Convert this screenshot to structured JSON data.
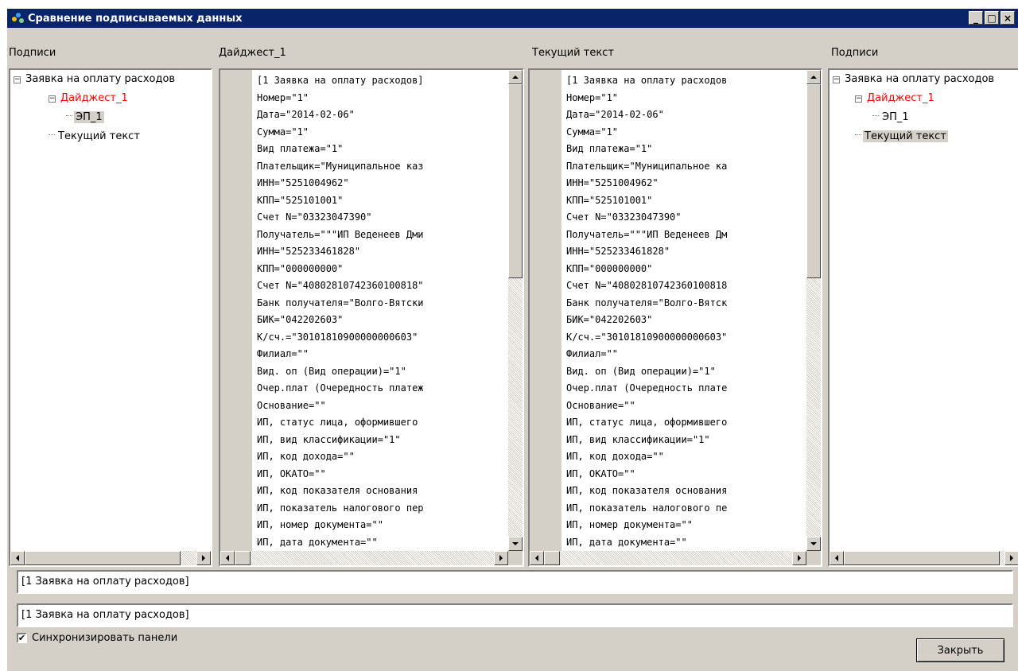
{
  "window": {
    "title": "Сравнение подписываемых данных",
    "minimize_glyph": "_",
    "maximize_glyph": "□",
    "close_glyph": "×"
  },
  "left_panel": {
    "label": "Подписи",
    "tree": {
      "root": "Заявка на оплату расходов",
      "digest": "Дайджест_1",
      "signature": "ЭП_1",
      "current_text": "Текущий текст"
    }
  },
  "digest_panel": {
    "label": "Дайджест_1",
    "lines": [
      "[1 Заявка на оплату расходов]",
      "Номер=\"1\"",
      "Дата=\"2014-02-06\"",
      "Сумма=\"1\"",
      "Вид платежа=\"1\"",
      "Плательщик=\"Муниципальное каз",
      "ИНН=\"5251004962\"",
      "КПП=\"525101001\"",
      "Счет N=\"03323047390\"",
      "Получатель=\"\"\"ИП Веденеев Дми",
      "ИНН=\"525233461828\"",
      "КПП=\"000000000\"",
      "Счет N=\"40802810742360100818\"",
      "Банк получателя=\"Волго-Вятски",
      "БИК=\"042202603\"",
      "К/сч.=\"30101810900000000603\"",
      "Филиал=\"\"",
      "Вид. оп (Вид операции)=\"1\"",
      "Очер.плат (Очередность платеж",
      "Основание=\"\"",
      "ИП, статус лица, оформившего",
      "ИП, вид классификации=\"1\"",
      "ИП, код дохода=\"\"",
      "ИП, ОКАТО=\"\"",
      "ИП, код показателя основания",
      "ИП, показатель налогового пер",
      "ИП, номер документа=\"\"",
      "ИП, дата документа=\"\""
    ]
  },
  "current_panel": {
    "label": "Текущий текст",
    "lines": [
      "[1 Заявка на оплату расходов",
      "Номер=\"1\"",
      "Дата=\"2014-02-06\"",
      "Сумма=\"1\"",
      "Вид платежа=\"1\"",
      "Плательщик=\"Муниципальное ка",
      "ИНН=\"5251004962\"",
      "КПП=\"525101001\"",
      "Счет N=\"03323047390\"",
      "Получатель=\"\"\"ИП Веденеев Дм",
      "ИНН=\"525233461828\"",
      "КПП=\"000000000\"",
      "Счет N=\"40802810742360100818",
      "Банк получателя=\"Волго-Вятск",
      "БИК=\"042202603\"",
      "К/сч.=\"30101810900000000603\"",
      "Филиал=\"\"",
      "Вид. оп (Вид операции)=\"1\"",
      "Очер.плат (Очередность плате",
      "Основание=\"\"",
      "ИП, статус лица, оформившего",
      "ИП, вид классификации=\"1\"",
      "ИП, код дохода=\"\"",
      "ИП, ОКАТО=\"\"",
      "ИП, код показателя основания",
      "ИП, показатель налогового пе",
      "ИП, номер документа=\"\"",
      "ИП, дата документа=\"\""
    ]
  },
  "right_panel": {
    "label": "Подписи",
    "tree": {
      "root": "Заявка на оплату расходов",
      "digest": "Дайджест_1",
      "signature": "ЭП_1",
      "current_text": "Текущий текст"
    }
  },
  "footer": {
    "field_top": "[1 Заявка на оплату расходов]",
    "field_bottom": "[1 Заявка на оплату расходов]",
    "sync_label": "Синхронизировать панели",
    "sync_checked": true,
    "check_glyph": "✔",
    "close_label": "Закрыть"
  },
  "colors": {
    "titlebar": "#0a246a",
    "face": "#d4d0c8",
    "highlight_red": "#ff0000"
  }
}
